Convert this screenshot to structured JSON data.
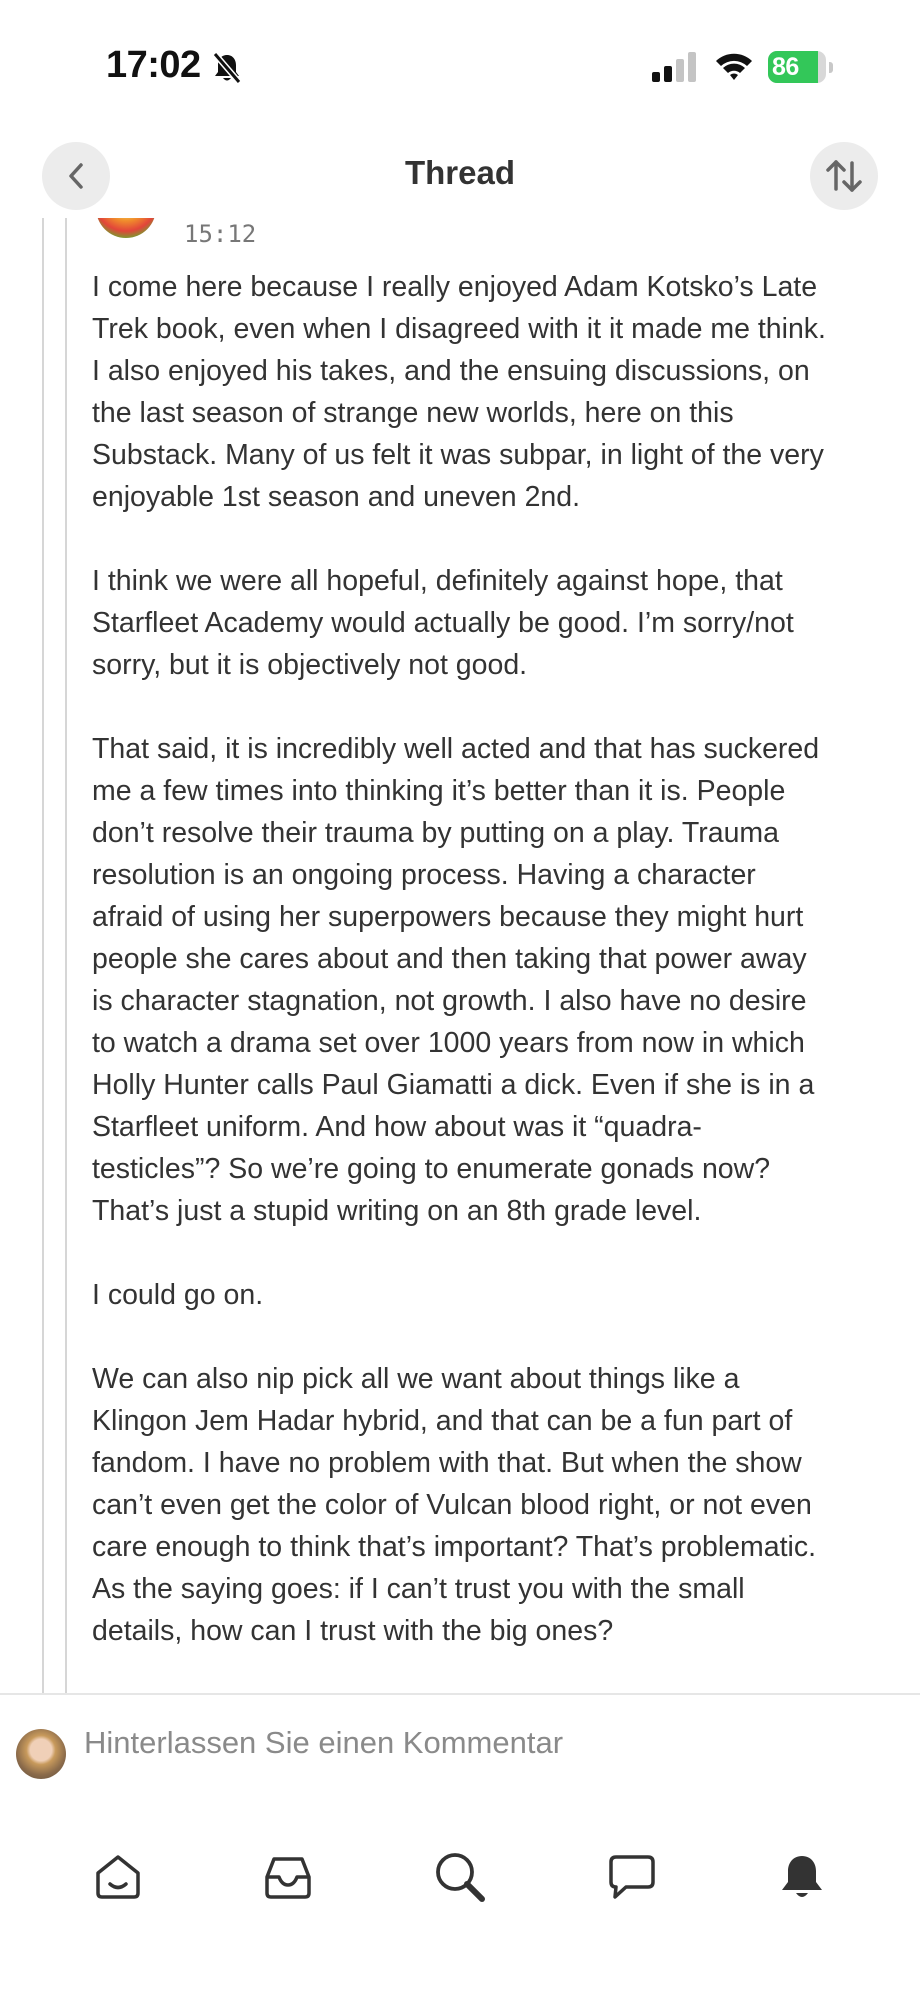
{
  "status_bar": {
    "time": "17:02",
    "battery_percent": "86",
    "battery_level": 0.86,
    "icons": [
      "bell-slash-icon",
      "cellular-signal-icon",
      "wifi-icon",
      "battery-charging-icon"
    ]
  },
  "header": {
    "title": "Thread",
    "back_icon": "chevron-left-icon",
    "sort_icon": "sort-arrows-icon"
  },
  "comment": {
    "timestamp": "15:12",
    "paragraphs": [
      "I come here because I really enjoyed Adam Kotsko’s Late\nTrek book, even when I disagreed with it it made me think.\nI also enjoyed his takes, and the ensuing discussions, on\nthe last season of strange new worlds, here on this\nSubstack. Many of us felt it was subpar, in light of the very\nenjoyable 1st season and uneven 2nd.",
      "I think we were all hopeful, definitely against hope, that\nStarfleet Academy would actually be good. I’m sorry/not\nsorry, but it is objectively not good.",
      "That said, it is incredibly well acted and that has suckered\nme a few times into thinking it’s better than it is. People\ndon’t resolve their trauma by putting on a play. Trauma\nresolution is an ongoing process. Having a character\nafraid of using her superpowers because they might hurt\npeople she cares about and then taking that power away\nis character stagnation, not growth. I also have no desire\nto watch a drama set over 1000 years from now in which\nHolly Hunter calls Paul Giamatti a dick. Even if she is in a\nStarfleet uniform. And how about was it “quadra-\ntesticles”? So we’re going to enumerate gonads now?\nThat’s just a stupid writing on an 8th grade level.",
      "I could go on.",
      "We can also nip pick all we want about things like a\nKlingon Jem Hadar hybrid, and that can be a fun part of\nfandom. I have no problem with that. But when the show\ncan’t even get the color of Vulcan blood right, or not even\ncare enough to think that’s important? That’s problematic.\nAs the saying goes: if I can’t trust you with the small\ndetails, how can I trust with the big ones?"
    ]
  },
  "composer": {
    "placeholder": "Hinterlassen Sie einen Kommentar"
  },
  "tab_bar": {
    "items": [
      "home-icon",
      "inbox-icon",
      "search-icon",
      "chat-icon",
      "notifications-icon"
    ]
  },
  "colors": {
    "battery_green": "#33c759",
    "text": "#333333",
    "muted": "#8a8a8a",
    "thread_line": "#d6d6d6"
  }
}
